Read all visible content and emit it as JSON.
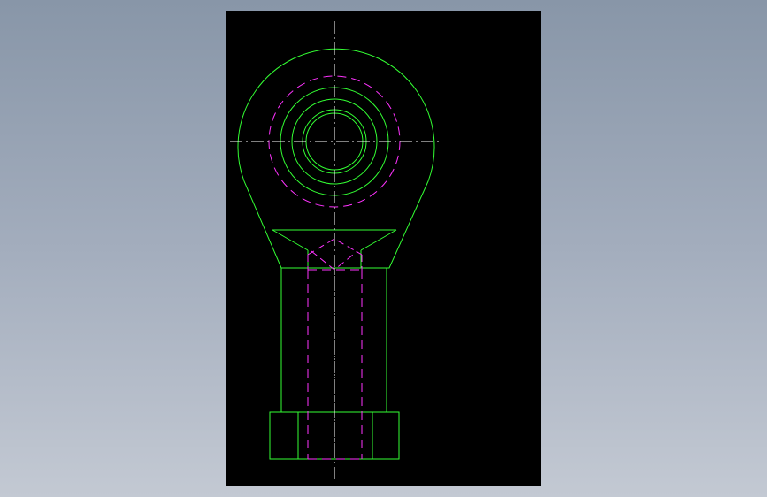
{
  "viewer": {
    "background": "#000000",
    "page_gradient": [
      "#8896a8",
      "#c3c9d3"
    ]
  },
  "drawing": {
    "subject": "rod end bearing",
    "view": "front",
    "colors": {
      "outline": "#33ff33",
      "hidden": "#ff33ff",
      "centerline": "#ffffff"
    }
  }
}
